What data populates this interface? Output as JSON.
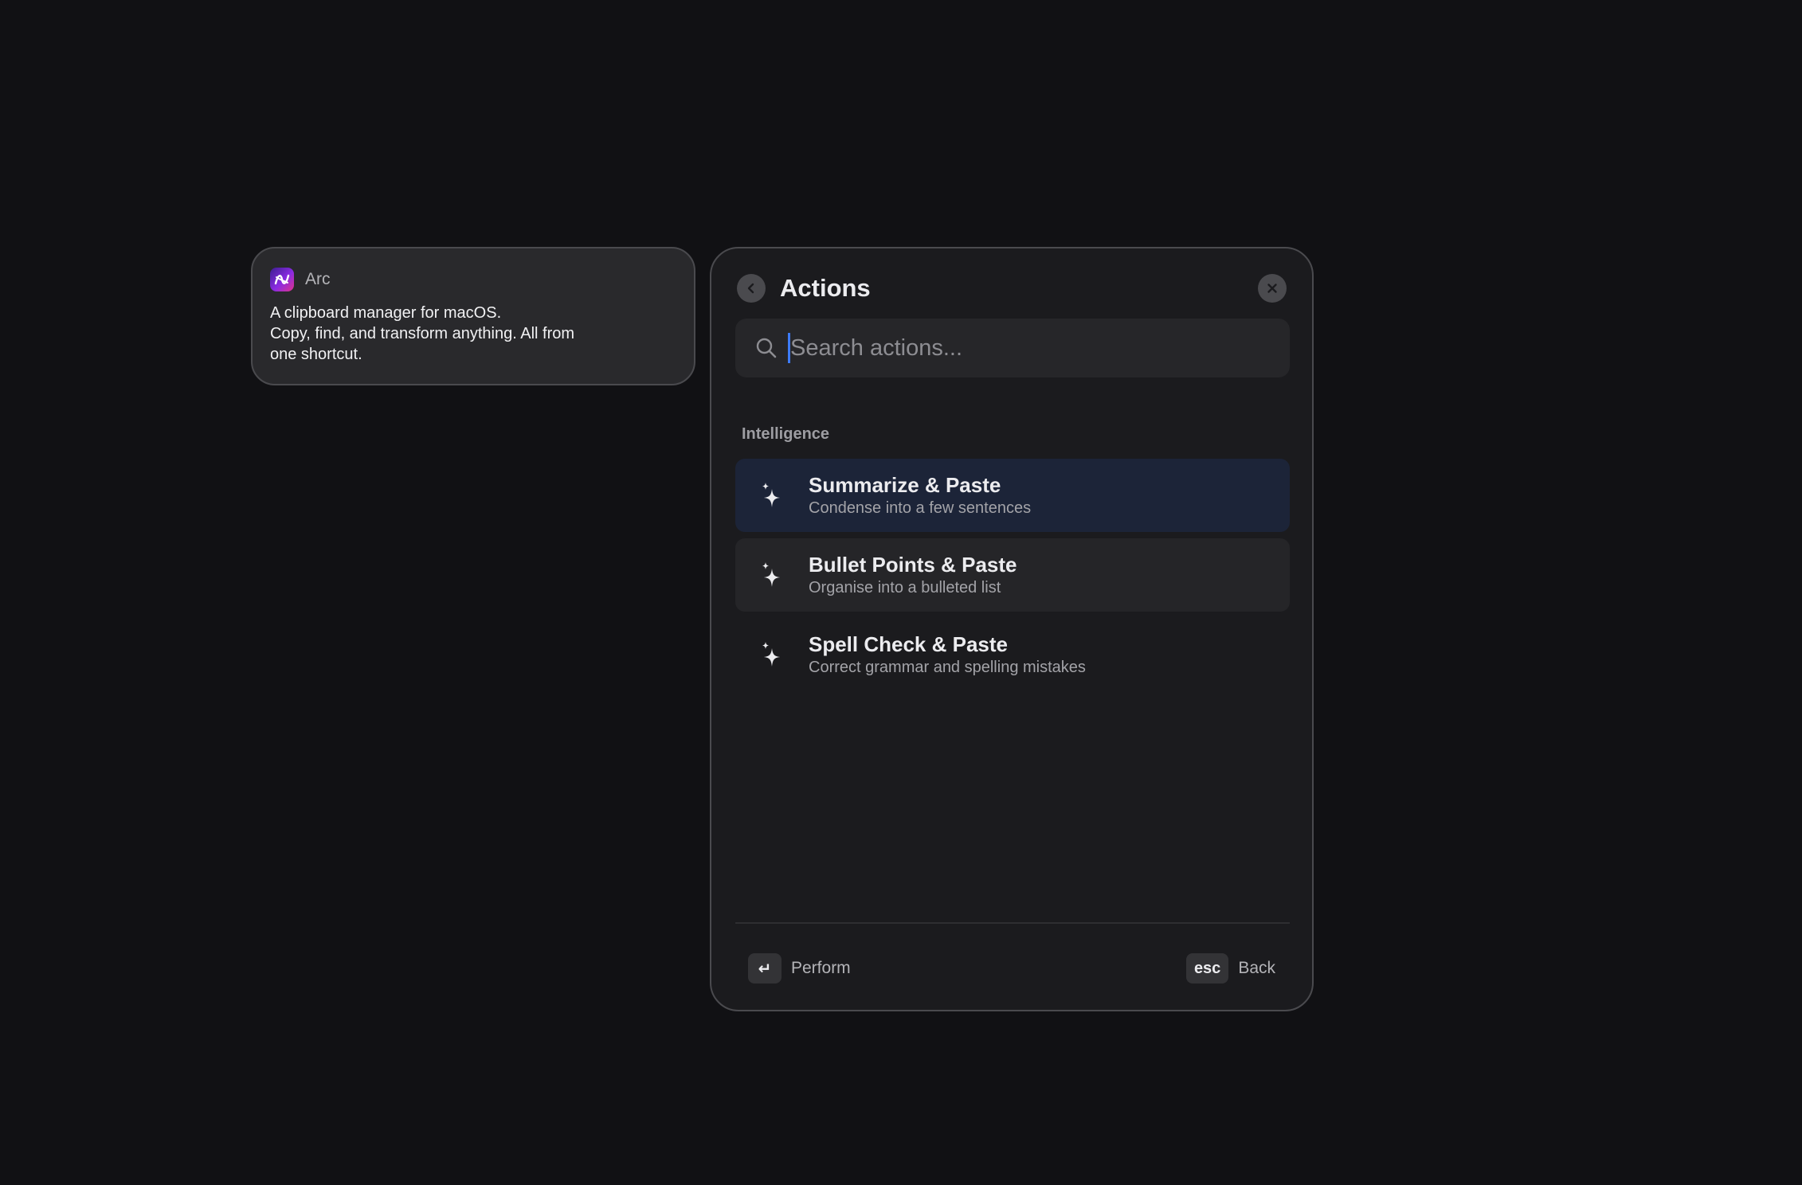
{
  "clipboard": {
    "app_name": "Arc",
    "app_icon": "arc-app-icon",
    "text": "A clipboard manager for macOS.\nCopy, find, and transform anything. All from\none shortcut."
  },
  "actions_panel": {
    "title": "Actions",
    "back_icon": "chevron-left-icon",
    "close_icon": "close-icon",
    "search": {
      "placeholder": "Search actions...",
      "value": ""
    },
    "section": "Intelligence",
    "items": [
      {
        "title": "Summarize & Paste",
        "subtitle": "Condense into a few sentences",
        "icon": "sparkle-icon",
        "state": "selected"
      },
      {
        "title": "Bullet Points & Paste",
        "subtitle": "Organise into a bulleted list",
        "icon": "sparkle-icon",
        "state": "hover"
      },
      {
        "title": "Spell Check & Paste",
        "subtitle": "Correct grammar and spelling mistakes",
        "icon": "sparkle-icon",
        "state": "normal"
      }
    ],
    "footer": {
      "perform_key": "↵",
      "perform_label": "Perform",
      "back_key": "esc",
      "back_label": "Back"
    }
  },
  "colors": {
    "background": "#111114",
    "panel": "#1b1b1e",
    "selected_row": "#1c2438",
    "caret": "#3d7bf7"
  }
}
